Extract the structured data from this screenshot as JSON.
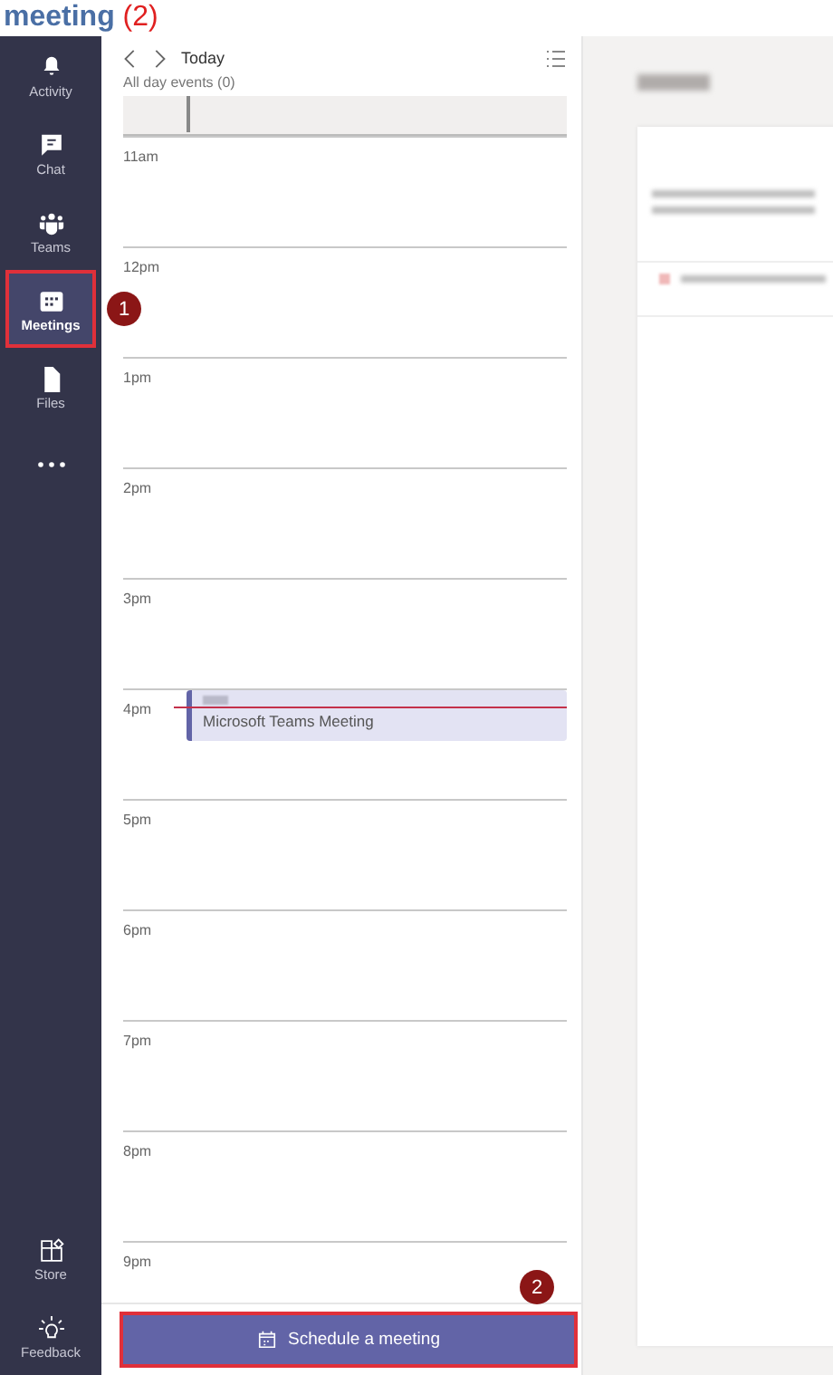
{
  "heading": {
    "text": "meeting",
    "count": "(2)"
  },
  "sidebar": {
    "items": [
      {
        "kind": "app",
        "label": "Activity",
        "selected": false
      },
      {
        "kind": "app",
        "label": "Chat",
        "selected": false
      },
      {
        "kind": "app",
        "label": "Teams",
        "selected": false
      },
      {
        "kind": "app",
        "label": "Meetings",
        "selected": true,
        "callout": "1"
      },
      {
        "kind": "app",
        "label": "Files",
        "selected": false
      },
      {
        "kind": "more",
        "selected": false
      }
    ],
    "bottom_items": [
      {
        "kind": "app",
        "label": "Store",
        "selected": false
      },
      {
        "kind": "app",
        "label": "Feedback",
        "selected": false
      }
    ]
  },
  "calendar": {
    "nav_label": "Today",
    "all_day": "All day events (0)",
    "hours": [
      {
        "label": "11am",
        "now": false
      },
      {
        "label": "12pm",
        "now": false
      },
      {
        "label": "1pm",
        "now": false
      },
      {
        "label": "2pm",
        "now": false
      },
      {
        "label": "3pm",
        "now": false
      },
      {
        "label": "4pm",
        "now": true,
        "event": {
          "title": "Microsoft Teams Meeting"
        }
      },
      {
        "label": "5pm",
        "now": false
      },
      {
        "label": "6pm",
        "now": false
      },
      {
        "label": "7pm",
        "now": false
      },
      {
        "label": "8pm",
        "now": false
      },
      {
        "label": "9pm",
        "now": false
      }
    ],
    "schedule_button": {
      "label": "Schedule a meeting",
      "callout": "2"
    }
  }
}
